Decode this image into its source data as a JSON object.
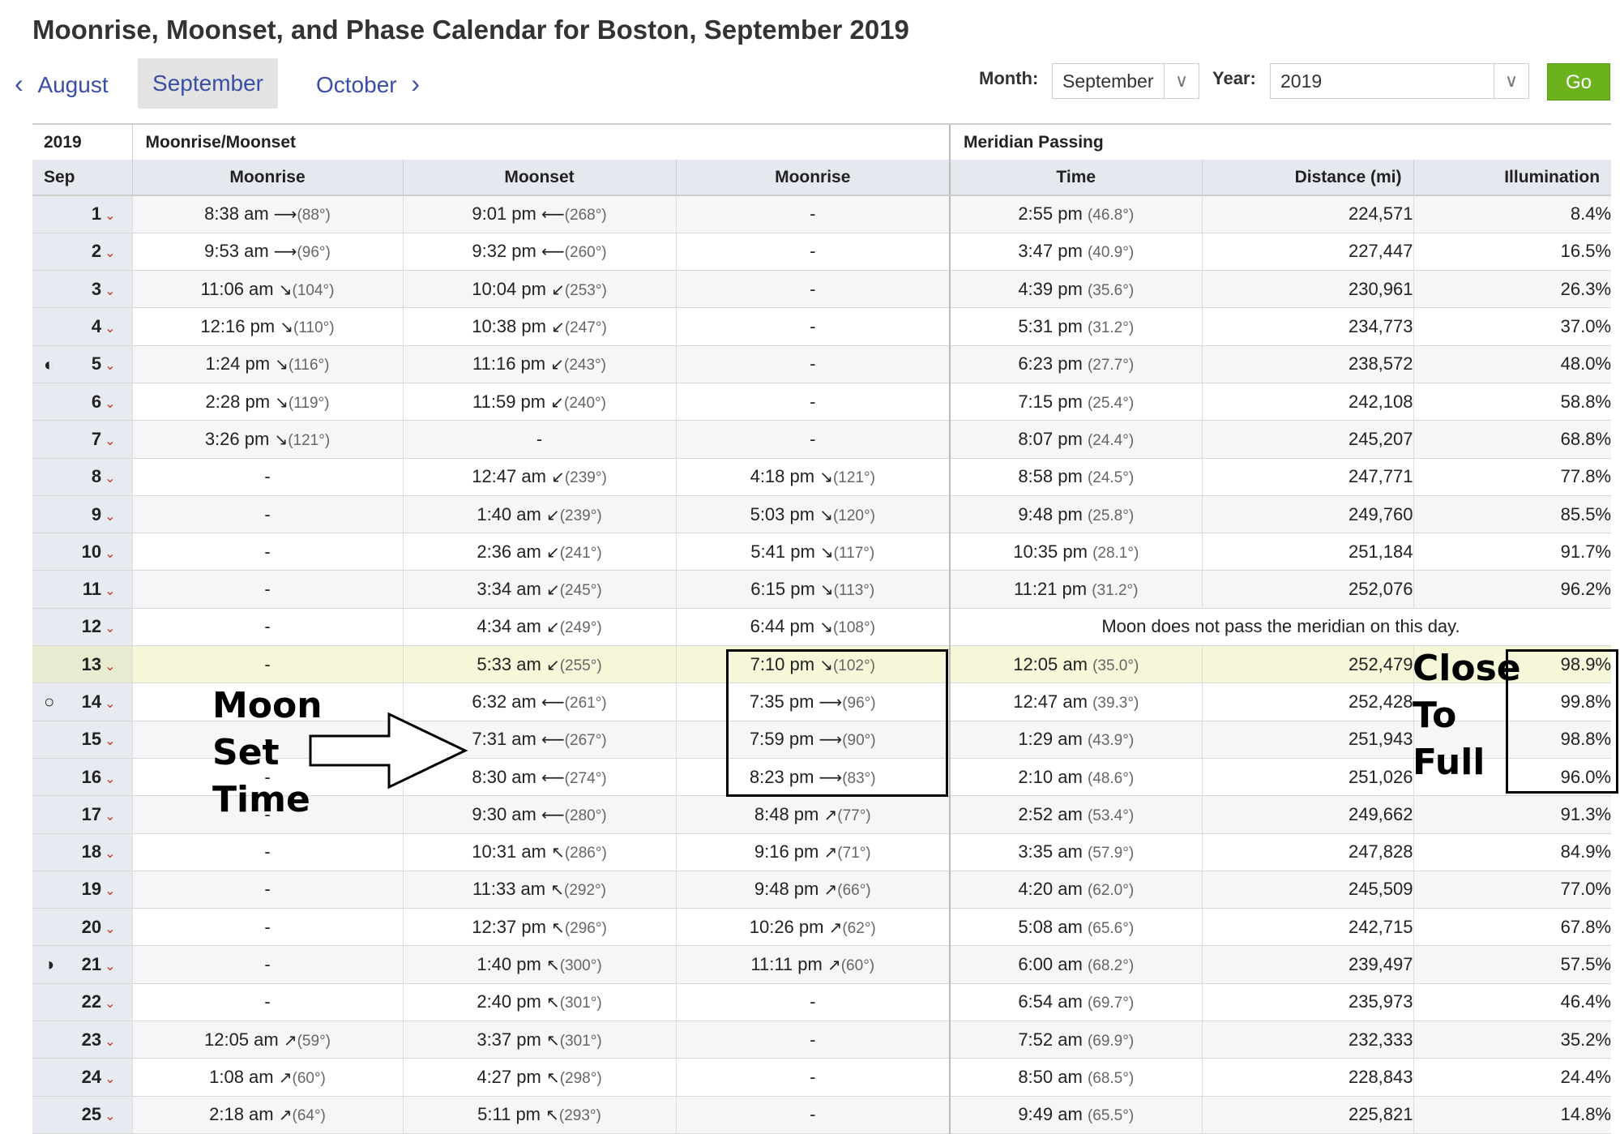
{
  "page_title": "Moonrise, Moonset, and Phase Calendar for Boston, September 2019",
  "nav": {
    "prev": "August",
    "current": "September",
    "next": "October"
  },
  "form": {
    "month_label": "Month:",
    "month_value": "September",
    "year_label": "Year:",
    "year_value": "2019",
    "go_label": "Go"
  },
  "table": {
    "group_headers": {
      "year": "2019",
      "moonrise_moonset": "Moonrise/Moonset",
      "meridian": "Meridian Passing"
    },
    "col_headers": {
      "month": "Sep",
      "moonrise1": "Moonrise",
      "moonset": "Moonset",
      "moonrise2": "Moonrise",
      "time": "Time",
      "distance": "Distance (mi)",
      "illumination": "Illumination"
    },
    "rows": [
      {
        "day": "1",
        "phase": "",
        "mr1": "8:38 am",
        "mr1_a": "⟶",
        "mr1_d": "(88°)",
        "ms": "9:01 pm",
        "ms_a": "⟵",
        "ms_d": "(268°)",
        "mr2": "-",
        "mr2_a": "",
        "mr2_d": "",
        "mt": "2:55 pm",
        "mt_d": "(46.8°)",
        "dist": "224,571",
        "illum": "8.4%"
      },
      {
        "day": "2",
        "phase": "",
        "mr1": "9:53 am",
        "mr1_a": "⟶",
        "mr1_d": "(96°)",
        "ms": "9:32 pm",
        "ms_a": "⟵",
        "ms_d": "(260°)",
        "mr2": "-",
        "mr2_a": "",
        "mr2_d": "",
        "mt": "3:47 pm",
        "mt_d": "(40.9°)",
        "dist": "227,447",
        "illum": "16.5%"
      },
      {
        "day": "3",
        "phase": "",
        "mr1": "11:06 am",
        "mr1_a": "↘",
        "mr1_d": "(104°)",
        "ms": "10:04 pm",
        "ms_a": "↙",
        "ms_d": "(253°)",
        "mr2": "-",
        "mr2_a": "",
        "mr2_d": "",
        "mt": "4:39 pm",
        "mt_d": "(35.6°)",
        "dist": "230,961",
        "illum": "26.3%"
      },
      {
        "day": "4",
        "phase": "",
        "mr1": "12:16 pm",
        "mr1_a": "↘",
        "mr1_d": "(110°)",
        "ms": "10:38 pm",
        "ms_a": "↙",
        "ms_d": "(247°)",
        "mr2": "-",
        "mr2_a": "",
        "mr2_d": "",
        "mt": "5:31 pm",
        "mt_d": "(31.2°)",
        "dist": "234,773",
        "illum": "37.0%"
      },
      {
        "day": "5",
        "phase": "◐",
        "mr1": "1:24 pm",
        "mr1_a": "↘",
        "mr1_d": "(116°)",
        "ms": "11:16 pm",
        "ms_a": "↙",
        "ms_d": "(243°)",
        "mr2": "-",
        "mr2_a": "",
        "mr2_d": "",
        "mt": "6:23 pm",
        "mt_d": "(27.7°)",
        "dist": "238,572",
        "illum": "48.0%"
      },
      {
        "day": "6",
        "phase": "",
        "mr1": "2:28 pm",
        "mr1_a": "↘",
        "mr1_d": "(119°)",
        "ms": "11:59 pm",
        "ms_a": "↙",
        "ms_d": "(240°)",
        "mr2": "-",
        "mr2_a": "",
        "mr2_d": "",
        "mt": "7:15 pm",
        "mt_d": "(25.4°)",
        "dist": "242,108",
        "illum": "58.8%"
      },
      {
        "day": "7",
        "phase": "",
        "mr1": "3:26 pm",
        "mr1_a": "↘",
        "mr1_d": "(121°)",
        "ms": "-",
        "ms_a": "",
        "ms_d": "",
        "mr2": "-",
        "mr2_a": "",
        "mr2_d": "",
        "mt": "8:07 pm",
        "mt_d": "(24.4°)",
        "dist": "245,207",
        "illum": "68.8%"
      },
      {
        "day": "8",
        "phase": "",
        "mr1": "-",
        "mr1_a": "",
        "mr1_d": "",
        "ms": "12:47 am",
        "ms_a": "↙",
        "ms_d": "(239°)",
        "mr2": "4:18 pm",
        "mr2_a": "↘",
        "mr2_d": "(121°)",
        "mt": "8:58 pm",
        "mt_d": "(24.5°)",
        "dist": "247,771",
        "illum": "77.8%"
      },
      {
        "day": "9",
        "phase": "",
        "mr1": "-",
        "mr1_a": "",
        "mr1_d": "",
        "ms": "1:40 am",
        "ms_a": "↙",
        "ms_d": "(239°)",
        "mr2": "5:03 pm",
        "mr2_a": "↘",
        "mr2_d": "(120°)",
        "mt": "9:48 pm",
        "mt_d": "(25.8°)",
        "dist": "249,760",
        "illum": "85.5%"
      },
      {
        "day": "10",
        "phase": "",
        "mr1": "-",
        "mr1_a": "",
        "mr1_d": "",
        "ms": "2:36 am",
        "ms_a": "↙",
        "ms_d": "(241°)",
        "mr2": "5:41 pm",
        "mr2_a": "↘",
        "mr2_d": "(117°)",
        "mt": "10:35 pm",
        "mt_d": "(28.1°)",
        "dist": "251,184",
        "illum": "91.7%"
      },
      {
        "day": "11",
        "phase": "",
        "mr1": "-",
        "mr1_a": "",
        "mr1_d": "",
        "ms": "3:34 am",
        "ms_a": "↙",
        "ms_d": "(245°)",
        "mr2": "6:15 pm",
        "mr2_a": "↘",
        "mr2_d": "(113°)",
        "mt": "11:21 pm",
        "mt_d": "(31.2°)",
        "dist": "252,076",
        "illum": "96.2%"
      },
      {
        "day": "12",
        "phase": "",
        "mr1": "-",
        "mr1_a": "",
        "mr1_d": "",
        "ms": "4:34 am",
        "ms_a": "↙",
        "ms_d": "(249°)",
        "mr2": "6:44 pm",
        "mr2_a": "↘",
        "mr2_d": "(108°)",
        "no_meridian": "Moon does not pass the meridian on this day."
      },
      {
        "day": "13",
        "phase": "",
        "highlight": true,
        "mr1": "-",
        "mr1_a": "",
        "mr1_d": "",
        "ms": "5:33 am",
        "ms_a": "↙",
        "ms_d": "(255°)",
        "mr2": "7:10 pm",
        "mr2_a": "↘",
        "mr2_d": "(102°)",
        "mt": "12:05 am",
        "mt_d": "(35.0°)",
        "dist": "252,479",
        "illum": "98.9%"
      },
      {
        "day": "14",
        "phase": "○",
        "mr1": "-",
        "mr1_a": "",
        "mr1_d": "",
        "ms": "6:32 am",
        "ms_a": "⟵",
        "ms_d": "(261°)",
        "mr2": "7:35 pm",
        "mr2_a": "⟶",
        "mr2_d": "(96°)",
        "mt": "12:47 am",
        "mt_d": "(39.3°)",
        "dist": "252,428",
        "illum": "99.8%"
      },
      {
        "day": "15",
        "phase": "",
        "mr1": "-",
        "mr1_a": "",
        "mr1_d": "",
        "ms": "7:31 am",
        "ms_a": "⟵",
        "ms_d": "(267°)",
        "mr2": "7:59 pm",
        "mr2_a": "⟶",
        "mr2_d": "(90°)",
        "mt": "1:29 am",
        "mt_d": "(43.9°)",
        "dist": "251,943",
        "illum": "98.8%"
      },
      {
        "day": "16",
        "phase": "",
        "mr1": "-",
        "mr1_a": "",
        "mr1_d": "",
        "ms": "8:30 am",
        "ms_a": "⟵",
        "ms_d": "(274°)",
        "mr2": "8:23 pm",
        "mr2_a": "⟶",
        "mr2_d": "(83°)",
        "mt": "2:10 am",
        "mt_d": "(48.6°)",
        "dist": "251,026",
        "illum": "96.0%"
      },
      {
        "day": "17",
        "phase": "",
        "mr1": "-",
        "mr1_a": "",
        "mr1_d": "",
        "ms": "9:30 am",
        "ms_a": "⟵",
        "ms_d": "(280°)",
        "mr2": "8:48 pm",
        "mr2_a": "↗",
        "mr2_d": "(77°)",
        "mt": "2:52 am",
        "mt_d": "(53.4°)",
        "dist": "249,662",
        "illum": "91.3%"
      },
      {
        "day": "18",
        "phase": "",
        "mr1": "-",
        "mr1_a": "",
        "mr1_d": "",
        "ms": "10:31 am",
        "ms_a": "↖",
        "ms_d": "(286°)",
        "mr2": "9:16 pm",
        "mr2_a": "↗",
        "mr2_d": "(71°)",
        "mt": "3:35 am",
        "mt_d": "(57.9°)",
        "dist": "247,828",
        "illum": "84.9%"
      },
      {
        "day": "19",
        "phase": "",
        "mr1": "-",
        "mr1_a": "",
        "mr1_d": "",
        "ms": "11:33 am",
        "ms_a": "↖",
        "ms_d": "(292°)",
        "mr2": "9:48 pm",
        "mr2_a": "↗",
        "mr2_d": "(66°)",
        "mt": "4:20 am",
        "mt_d": "(62.0°)",
        "dist": "245,509",
        "illum": "77.0%"
      },
      {
        "day": "20",
        "phase": "",
        "mr1": "-",
        "mr1_a": "",
        "mr1_d": "",
        "ms": "12:37 pm",
        "ms_a": "↖",
        "ms_d": "(296°)",
        "mr2": "10:26 pm",
        "mr2_a": "↗",
        "mr2_d": "(62°)",
        "mt": "5:08 am",
        "mt_d": "(65.6°)",
        "dist": "242,715",
        "illum": "67.8%"
      },
      {
        "day": "21",
        "phase": "◑",
        "mr1": "-",
        "mr1_a": "",
        "mr1_d": "",
        "ms": "1:40 pm",
        "ms_a": "↖",
        "ms_d": "(300°)",
        "mr2": "11:11 pm",
        "mr2_a": "↗",
        "mr2_d": "(60°)",
        "mt": "6:00 am",
        "mt_d": "(68.2°)",
        "dist": "239,497",
        "illum": "57.5%"
      },
      {
        "day": "22",
        "phase": "",
        "mr1": "-",
        "mr1_a": "",
        "mr1_d": "",
        "ms": "2:40 pm",
        "ms_a": "↖",
        "ms_d": "(301°)",
        "mr2": "-",
        "mr2_a": "",
        "mr2_d": "",
        "mt": "6:54 am",
        "mt_d": "(69.7°)",
        "dist": "235,973",
        "illum": "46.4%"
      },
      {
        "day": "23",
        "phase": "",
        "mr1": "12:05 am",
        "mr1_a": "↗",
        "mr1_d": "(59°)",
        "ms": "3:37 pm",
        "ms_a": "↖",
        "ms_d": "(301°)",
        "mr2": "-",
        "mr2_a": "",
        "mr2_d": "",
        "mt": "7:52 am",
        "mt_d": "(69.9°)",
        "dist": "232,333",
        "illum": "35.2%"
      },
      {
        "day": "24",
        "phase": "",
        "mr1": "1:08 am",
        "mr1_a": "↗",
        "mr1_d": "(60°)",
        "ms": "4:27 pm",
        "ms_a": "↖",
        "ms_d": "(298°)",
        "mr2": "-",
        "mr2_a": "",
        "mr2_d": "",
        "mt": "8:50 am",
        "mt_d": "(68.5°)",
        "dist": "228,843",
        "illum": "24.4%"
      },
      {
        "day": "25",
        "phase": "",
        "mr1": "2:18 am",
        "mr1_a": "↗",
        "mr1_d": "(64°)",
        "ms": "5:11 pm",
        "ms_a": "↖",
        "ms_d": "(293°)",
        "mr2": "-",
        "mr2_a": "",
        "mr2_d": "",
        "mt": "9:49 am",
        "mt_d": "(65.5°)",
        "dist": "225,821",
        "illum": "14.8%"
      }
    ]
  },
  "annotations": {
    "moon_set_time": [
      "Moon",
      "Set",
      "Time"
    ],
    "close_to_full": [
      "Close",
      "To",
      "Full"
    ]
  }
}
